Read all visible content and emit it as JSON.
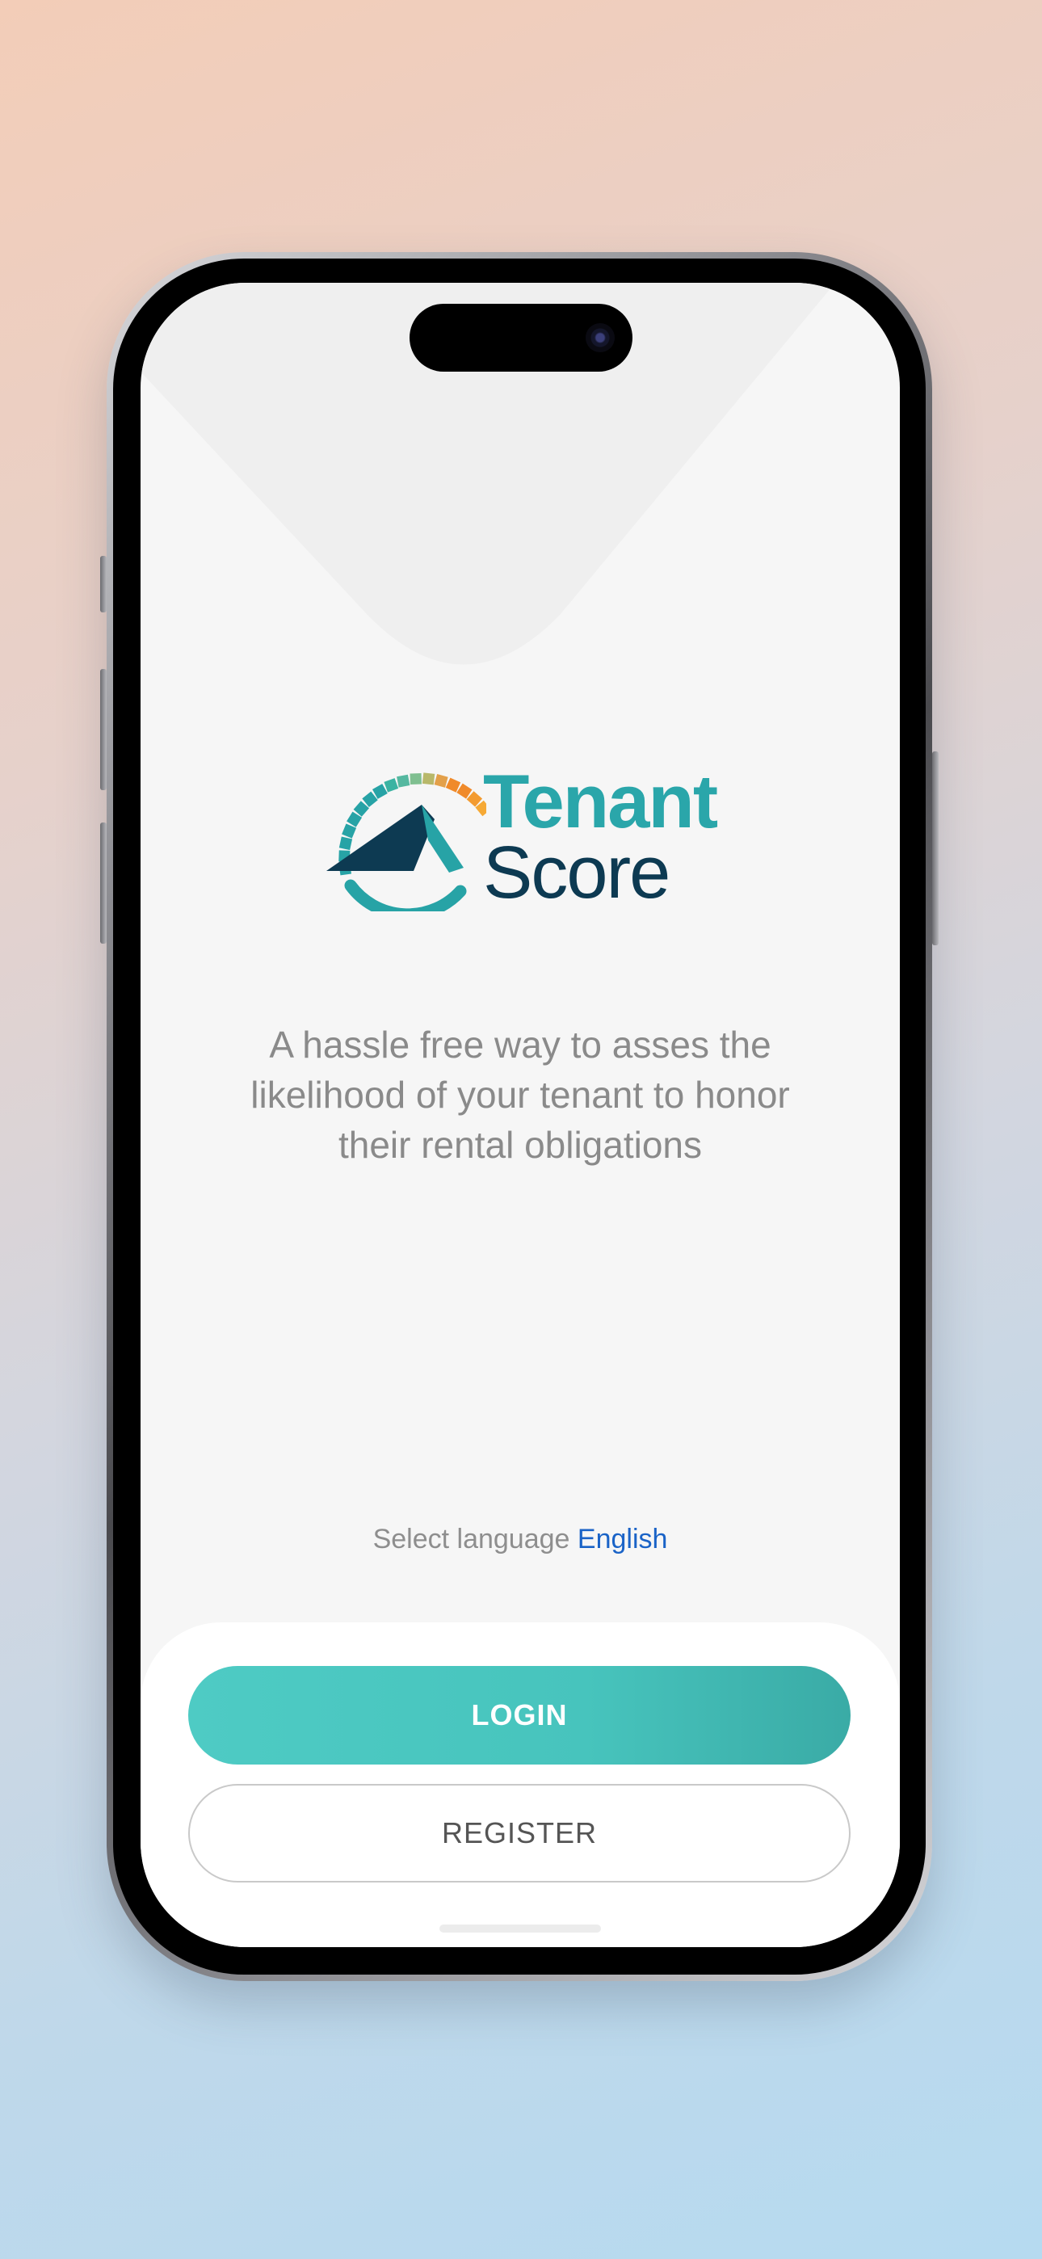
{
  "app": {
    "brand_line1": "Tenant",
    "brand_line2": "Score",
    "brand_color_primary": "#2aa6aa",
    "brand_color_dark": "#0d3a52",
    "brand_color_accent": "#f08a2a"
  },
  "splash": {
    "tagline_line1": "A hassle free way to asses the",
    "tagline_line2": "likelihood of your tenant to honor",
    "tagline_line3": "their rental obligations"
  },
  "language": {
    "prompt": "Select language",
    "selected": "English",
    "link_color": "#1a63c7"
  },
  "actions": {
    "login_label": "LOGIN",
    "register_label": "REGISTER",
    "login_color": "#47c4bd"
  },
  "icons": {
    "logo": "tenant-score-gauge-house-logo"
  }
}
